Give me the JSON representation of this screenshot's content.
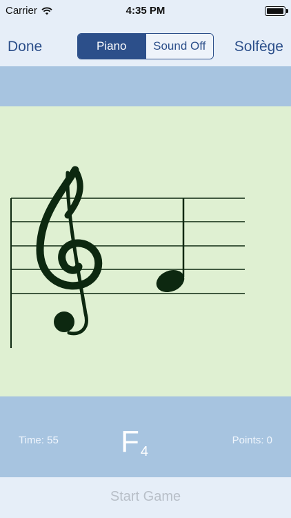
{
  "status_bar": {
    "carrier": "Carrier",
    "time": "4:35 PM",
    "battery_level": 1.0
  },
  "nav": {
    "done_label": "Done",
    "solfege_label": "Solfège",
    "segments": [
      {
        "label": "Piano",
        "selected": true
      },
      {
        "label": "Sound Off",
        "selected": false
      }
    ]
  },
  "staff": {
    "clef": "treble",
    "note": "F4"
  },
  "info": {
    "time_text": "Time: 55",
    "note_letter": "F",
    "note_octave": "4",
    "points_text": "Points: 0"
  },
  "footer": {
    "start_label": "Start Game"
  },
  "colors": {
    "nav_bg": "#e6eef8",
    "accent": "#2c4f8a",
    "band_blue": "#a7c4e0",
    "staff_bg": "#dff0d2",
    "ink": "#0d2810"
  },
  "icons": [
    "wifi-icon",
    "battery-icon",
    "treble-clef-icon",
    "quarter-note-icon"
  ]
}
